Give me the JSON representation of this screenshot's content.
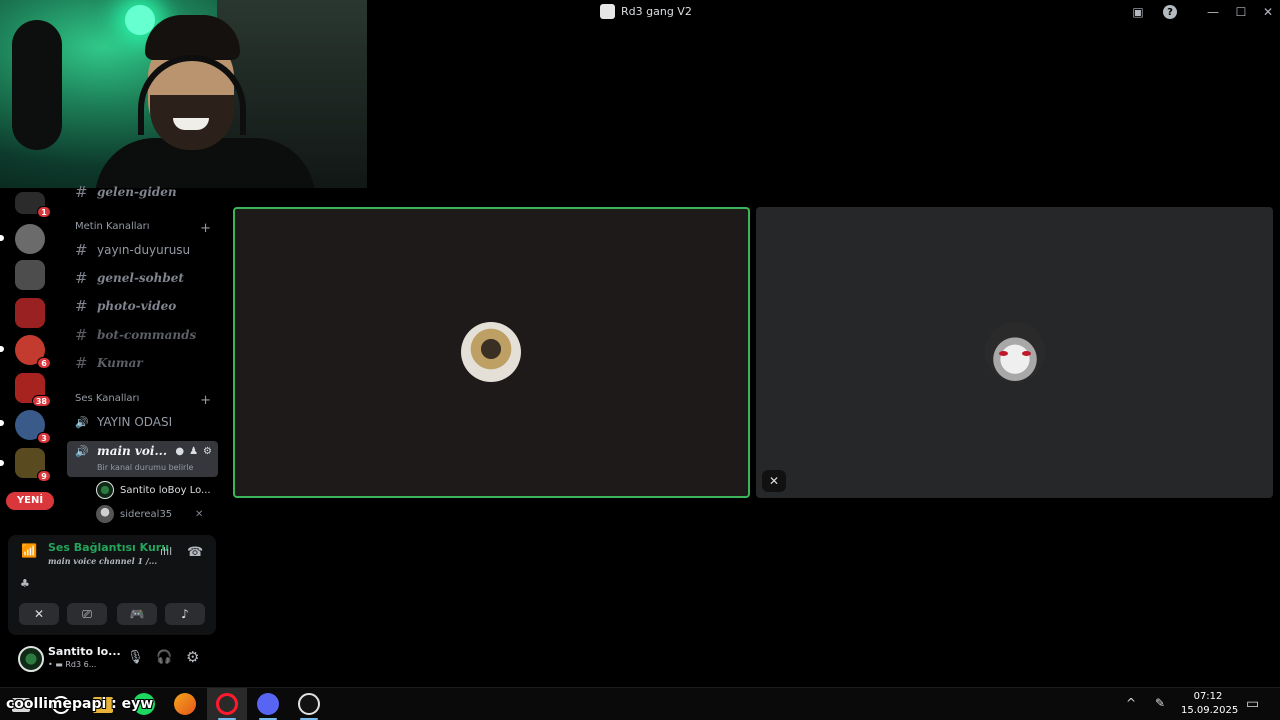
{
  "window": {
    "title": "Rd3 gang V2",
    "minimize_glyph": "—",
    "maximize_glyph": "☐",
    "close_glyph": "✕",
    "help_glyph": "?",
    "inbox_glyph": "▣"
  },
  "server_rail": {
    "new_label": "YENİ",
    "badges": [
      "1",
      "6",
      "38",
      "3",
      "9"
    ]
  },
  "sidebar": {
    "top_channel": "gelen-giden",
    "text_category": "Metin Kanalları",
    "text_channels": [
      "yayın-duyurusu",
      "genel-sohbet",
      "photo-video",
      "bot-commands",
      "Kumar"
    ],
    "voice_category": "Ses Kanalları",
    "voice_channels": [
      "YAYIN ODASI"
    ],
    "active_voice": {
      "name": "main voi...",
      "status": "Bir kanal durumu belirle",
      "users": [
        "Santito loBoy Lo...",
        "sidereal35"
      ]
    },
    "hash_glyph": "#",
    "plus_glyph": "+",
    "speaker_glyph": "🔊"
  },
  "voice_panel": {
    "title": "Ses Bağlantısı Kuru",
    "subtitle": "main voice channel 1 /...",
    "signal_glyph": "📶",
    "wave_glyph": "ılıl",
    "disconnect_glyph": "☎",
    "buttons": {
      "camera": "✕",
      "screen": "⎚",
      "activity": "🎮",
      "soundboard": "♪"
    }
  },
  "user_panel": {
    "name": "Santito lo...",
    "status": "• ▬ Rd3 6...",
    "mic_glyph": "🎙",
    "headset_glyph": "🎧",
    "settings_glyph": "⚙"
  },
  "stream": {
    "muted_glyph": "✕"
  },
  "taskbar": {
    "overlay_text": "coollimepapi : eyw",
    "time": "07:12",
    "date": "15.09.2025",
    "tray_chevron": "^",
    "notify_glyph": "▭"
  }
}
